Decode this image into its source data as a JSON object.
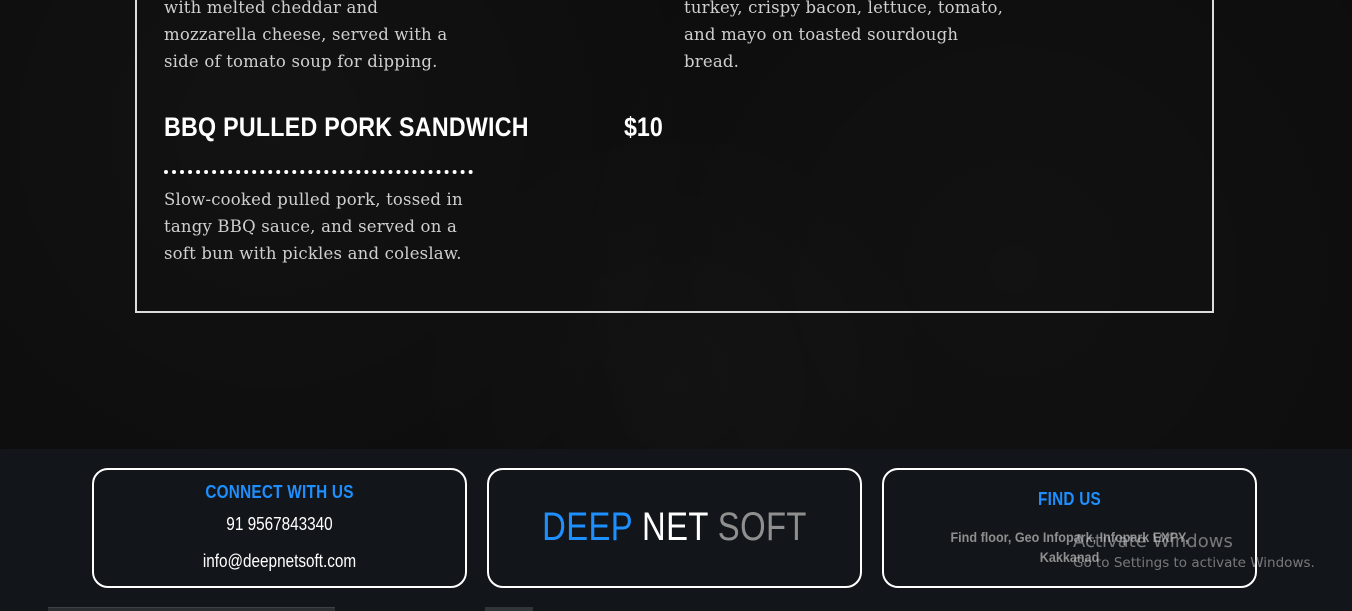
{
  "menu": {
    "left_top_description": "with melted cheddar and mozzarella cheese, served with a side of tomato soup for dipping.",
    "right_top_description": "turkey, crispy bacon, lettuce, tomato, and mayo on toasted sourdough bread.",
    "item": {
      "name": "BBQ PULLED PORK SANDWICH",
      "price": "$10",
      "description": "Slow-cooked pulled pork, tossed in tangy BBQ sauce, and served on a soft bun with pickles and coleslaw."
    }
  },
  "footer": {
    "connect": {
      "title": "CONNECT WITH US",
      "phone": "91 9567843340",
      "email": "info@deepnetsoft.com"
    },
    "brand": {
      "deep": "DEEP",
      "net": "NET",
      "soft": "SOFT"
    },
    "find": {
      "title": "FIND US",
      "address": "Find floor, Geo Infopark, Infopark EXPY, Kakkanad"
    }
  },
  "watermark": {
    "title": "Activate Windows",
    "subtitle": "Go to Settings to activate Windows."
  },
  "colors": {
    "accent": "#1e8fff",
    "background": "#0d0d0d",
    "footer": "#12161a"
  }
}
